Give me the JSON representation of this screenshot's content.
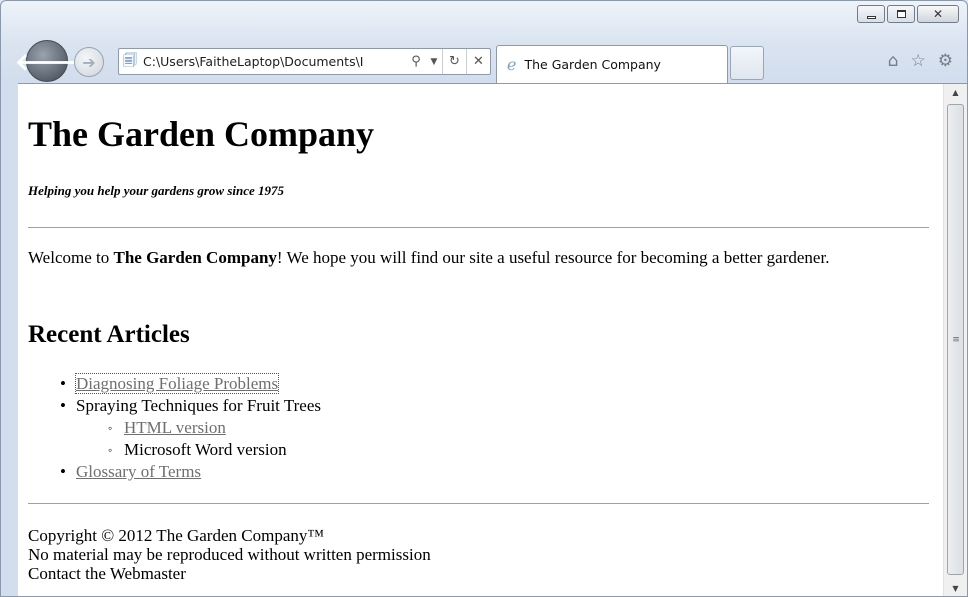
{
  "window": {
    "caption_buttons": [
      "minimize",
      "maximize",
      "close"
    ]
  },
  "toolbar": {
    "back_icon": "back-arrow-icon",
    "forward_icon": "forward-arrow-icon",
    "address_url": "C:\\Users\\FaitheLaptop\\Documents\\I",
    "address_tools": [
      "search-icon",
      "dropdown-icon",
      "refresh-icon",
      "stop-icon"
    ],
    "tab_title": "The Garden Company",
    "right_icons": [
      "home-icon",
      "favorites-star-icon",
      "gear-icon"
    ]
  },
  "page": {
    "site_title": "The Garden Company",
    "tagline": "Helping you help your gardens grow since 1975",
    "welcome_prefix": "Welcome to ",
    "welcome_bold": "The Garden Company",
    "welcome_suffix": "! We hope you will find our site a useful resource for becoming a better gardener.",
    "recent_heading": "Recent Articles",
    "articles": [
      {
        "label": "Diagnosing Foliage Problems",
        "link": true
      },
      {
        "label": "Spraying Techniques for Fruit Trees",
        "link": false,
        "sub": [
          {
            "label": "HTML version",
            "link": true
          },
          {
            "label": "Microsoft Word version",
            "link": false
          }
        ]
      },
      {
        "label": "Glossary of Terms",
        "link": true
      }
    ],
    "footer": {
      "copyright": "Copyright © 2012 The Garden Company™",
      "notice": "No material may be reproduced without written permission",
      "contact": "Contact the Webmaster"
    }
  }
}
